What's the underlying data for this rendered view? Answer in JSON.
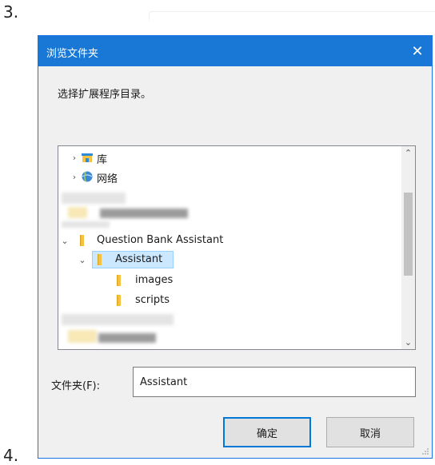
{
  "steps": {
    "three": "3.",
    "four": "4."
  },
  "dialog": {
    "title": "浏览文件夹",
    "close_glyph": "✕",
    "prompt": "选择扩展程序目录。",
    "tree": {
      "items": [
        {
          "label": "库",
          "icon": "library-icon",
          "expanded": false
        },
        {
          "label": "网络",
          "icon": "network-icon",
          "expanded": false
        },
        {
          "label": "Question Bank Assistant",
          "icon": "folder-icon",
          "expanded": true
        },
        {
          "label": "Assistant",
          "icon": "folder-icon",
          "expanded": true,
          "selected": true
        },
        {
          "label": "images",
          "icon": "folder-icon"
        },
        {
          "label": "scripts",
          "icon": "folder-icon"
        }
      ]
    },
    "folder_field": {
      "label": "文件夹(F):",
      "value": "Assistant"
    },
    "buttons": {
      "ok": "确定",
      "cancel": "取消"
    }
  },
  "colors": {
    "titlebar": "#1977d6",
    "selection": "#cce8ff",
    "folder": "#f5c242"
  }
}
